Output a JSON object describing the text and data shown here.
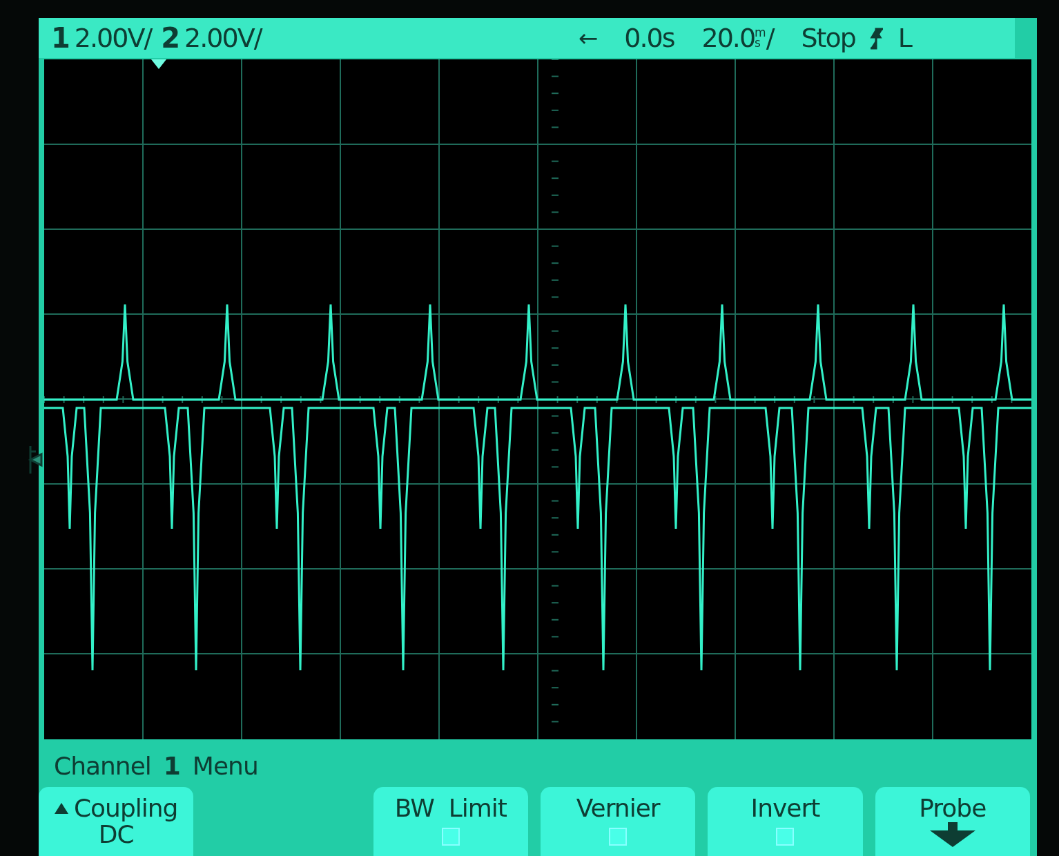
{
  "status_bar": {
    "channels": [
      {
        "number": "1",
        "scale": "2.00V/"
      },
      {
        "number": "2",
        "scale": "2.00V/"
      }
    ],
    "delay_arrow": "←",
    "delay": "0.0s",
    "timebase": {
      "value": "20.0",
      "unit_top": "m",
      "unit_bottom": "s",
      "suffix": "/"
    },
    "run_state": "Stop",
    "trigger_source": "L"
  },
  "menu": {
    "title_prefix": "Channel",
    "channel": "1",
    "title_suffix": "Menu"
  },
  "softkeys": [
    {
      "kind": "select",
      "label": "Coupling",
      "value": "DC"
    },
    {
      "kind": "toggle",
      "label": "BW  Limit",
      "checked": false
    },
    {
      "kind": "toggle",
      "label": "Vernier",
      "checked": false
    },
    {
      "kind": "toggle",
      "label": "Invert",
      "checked": false
    },
    {
      "kind": "submenu",
      "label": "Probe"
    }
  ]
}
